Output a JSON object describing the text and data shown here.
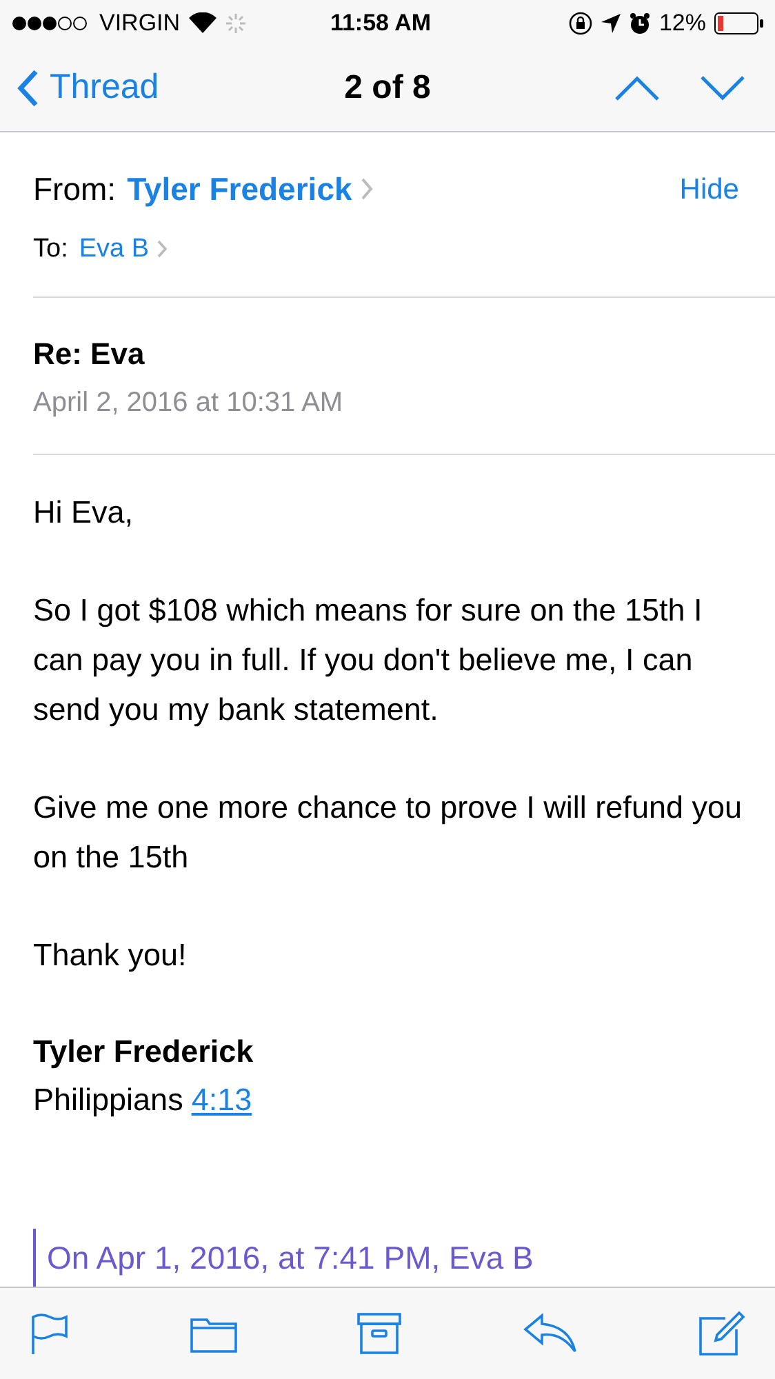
{
  "status_bar": {
    "carrier": "VIRGIN",
    "time": "11:58 AM",
    "battery": "12%"
  },
  "nav": {
    "back": "Thread",
    "title": "2 of 8"
  },
  "header": {
    "from_label": "From:",
    "from": "Tyler Frederick",
    "hide": "Hide",
    "to_label": "To:",
    "to": "Eva B"
  },
  "subject": "Re: Eva",
  "date": "April 2, 2016 at 10:31 AM",
  "body": [
    "Hi Eva,",
    "So I got $108 which means for sure on the 15th I can pay you in full. If you don't believe me, I can send you my bank statement.",
    "Give me one more chance to prove I will refund you on the 15th",
    "Thank you!"
  ],
  "signature": {
    "name": "Tyler Frederick",
    "text": "Philippians",
    "link": "4:13"
  },
  "quote": "On Apr 1, 2016, at 7:41 PM, Eva B"
}
